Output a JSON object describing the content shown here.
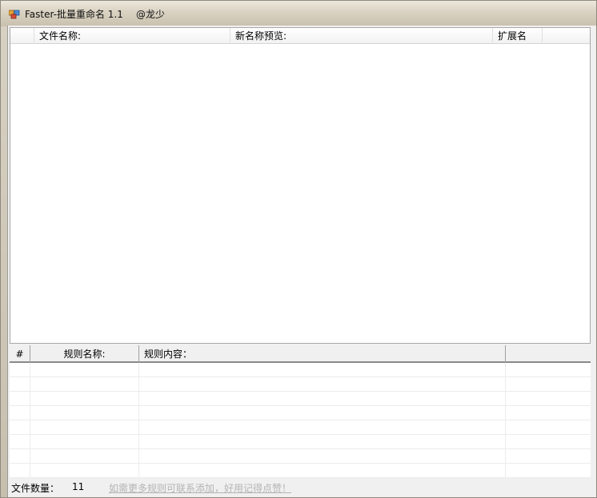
{
  "window": {
    "title": "Faster-批量重命名 1.1",
    "author": "@龙少"
  },
  "file_list": {
    "columns": [
      {
        "label": ""
      },
      {
        "label": "文件名称:"
      },
      {
        "label": "新名称预览:"
      },
      {
        "label": "扩展名"
      }
    ],
    "rows": []
  },
  "rules_grid": {
    "columns": [
      {
        "label": "#"
      },
      {
        "label": "规则名称:"
      },
      {
        "label": "规则内容："
      },
      {
        "label": ""
      }
    ],
    "rows": []
  },
  "status": {
    "file_count_label": "文件数量：",
    "file_count_value": "11",
    "link_text": "如需更多规则可联系添加，好用记得点赞！"
  },
  "colors": {
    "link_disabled": "#b4b4b4",
    "titlebar": "#d9d2c2"
  }
}
